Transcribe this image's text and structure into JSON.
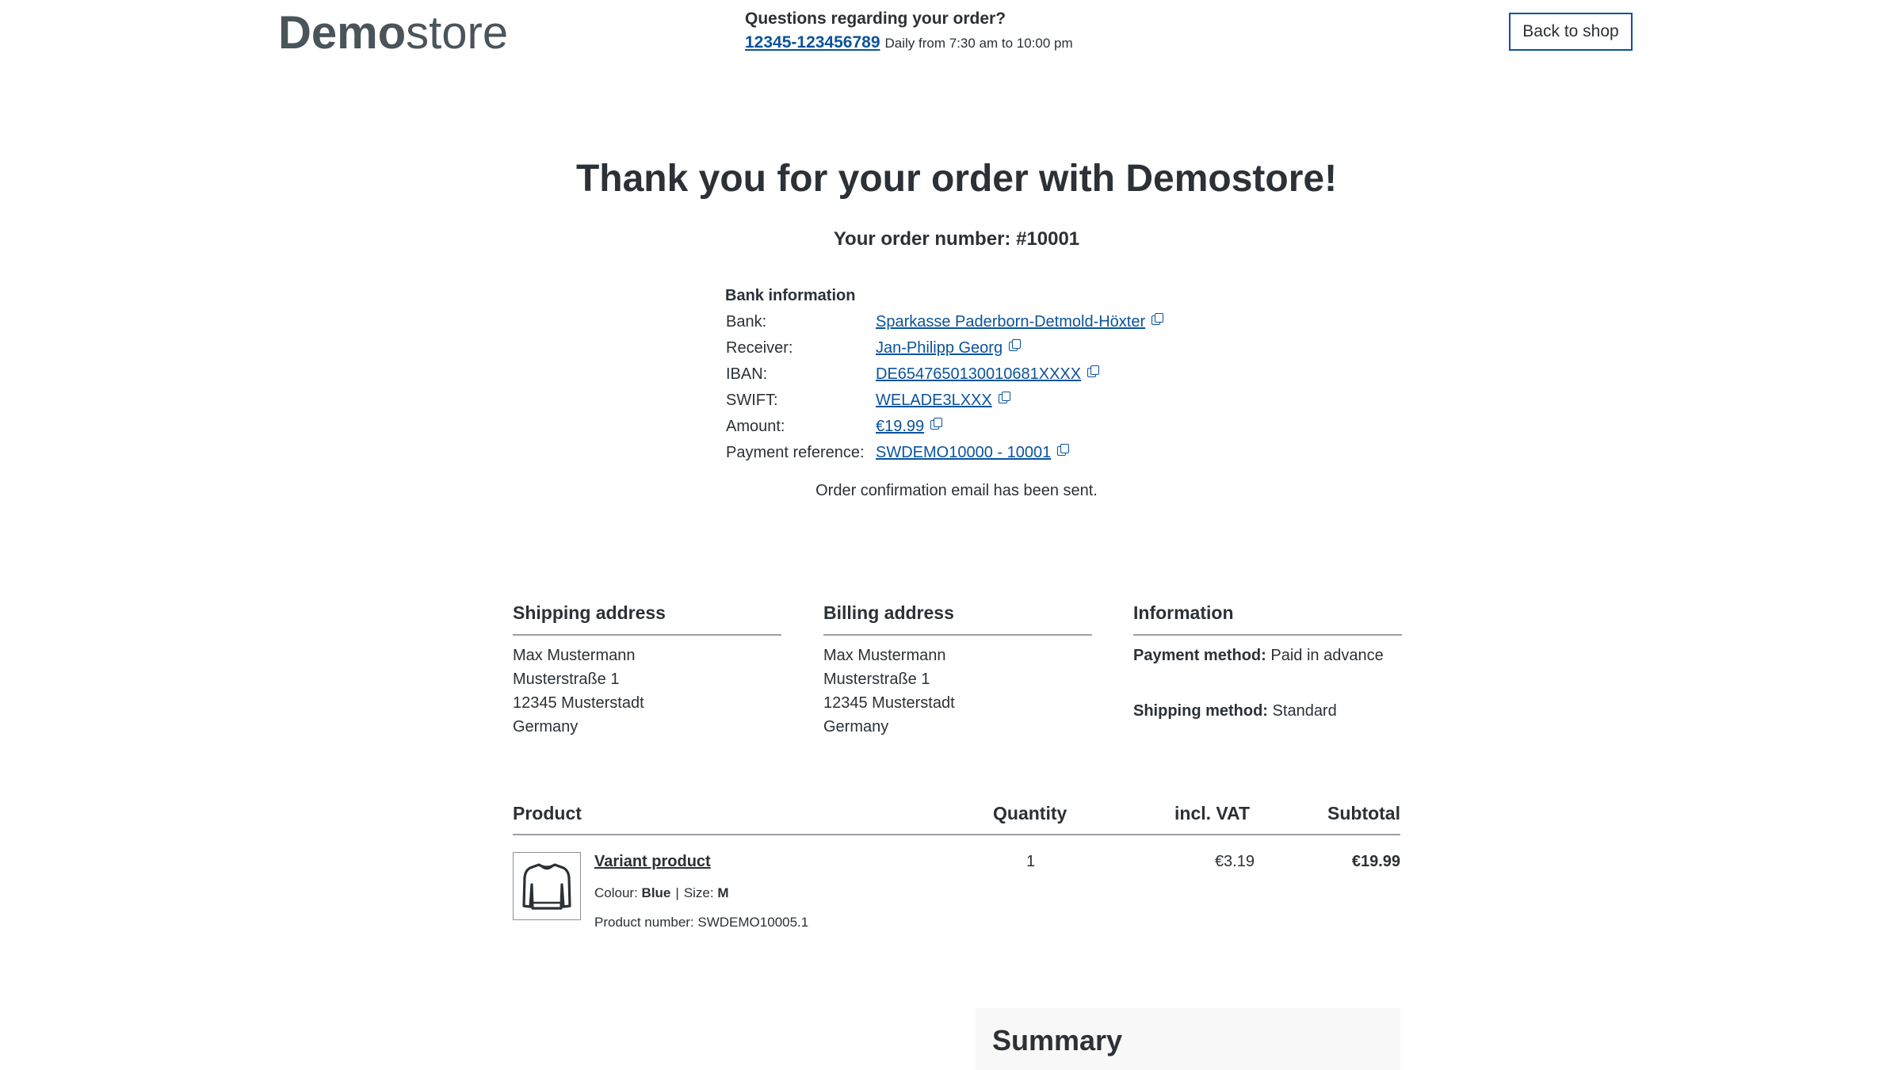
{
  "header": {
    "logo_bold": "Demo",
    "logo_light": "store",
    "help_question": "Questions regarding your order?",
    "phone": "12345-123456789",
    "hours": "Daily from 7:30 am to 10:00 pm",
    "back_button": "Back to shop"
  },
  "title": "Thank you for your order with Demostore!",
  "order_number_label": "Your order number: #10001",
  "bank": {
    "heading": "Bank information",
    "rows": [
      {
        "label": "Bank:",
        "value": "Sparkasse Paderborn-Detmold-Höxter"
      },
      {
        "label": "Receiver:",
        "value": "Jan-Philipp Georg"
      },
      {
        "label": "IBAN:",
        "value": "DE6547650130010681XXXX"
      },
      {
        "label": "SWIFT:",
        "value": "WELADE3LXXX"
      },
      {
        "label": "Amount:",
        "value": "€19.99"
      },
      {
        "label": "Payment reference:",
        "value": "SWDEMO10000 - 10001"
      }
    ],
    "icon": "copy-icon"
  },
  "confirmation": "Order confirmation email has been sent.",
  "shipping": {
    "heading": "Shipping address",
    "lines": [
      "Max Mustermann",
      "Musterstraße 1",
      "12345 Musterstadt",
      "Germany"
    ]
  },
  "billing": {
    "heading": "Billing address",
    "lines": [
      "Max Mustermann",
      "Musterstraße 1",
      "12345 Musterstadt",
      "Germany"
    ]
  },
  "information": {
    "heading": "Information",
    "payment_label": "Payment method:",
    "payment_value": "Paid in advance",
    "shipping_label": "Shipping method:",
    "shipping_value": "Standard"
  },
  "table": {
    "headers": {
      "product": "Product",
      "quantity": "Quantity",
      "vat": "incl. VAT",
      "subtotal": "Subtotal"
    },
    "item": {
      "name": "Variant product",
      "colour_label": "Colour:",
      "colour_value": "Blue",
      "separator": "|",
      "size_label": "Size:",
      "size_value": "M",
      "number_label": "Product number: SWDEMO10005.1",
      "quantity": "1",
      "vat": "€3.19",
      "subtotal": "€19.99",
      "icon": "sweater-icon"
    }
  },
  "summary": {
    "heading": "Summary"
  },
  "colors": {
    "link": "#0b539b",
    "text": "#2b3136",
    "divider": "#9aa0a5",
    "summary_bg": "#f8f8f8"
  }
}
